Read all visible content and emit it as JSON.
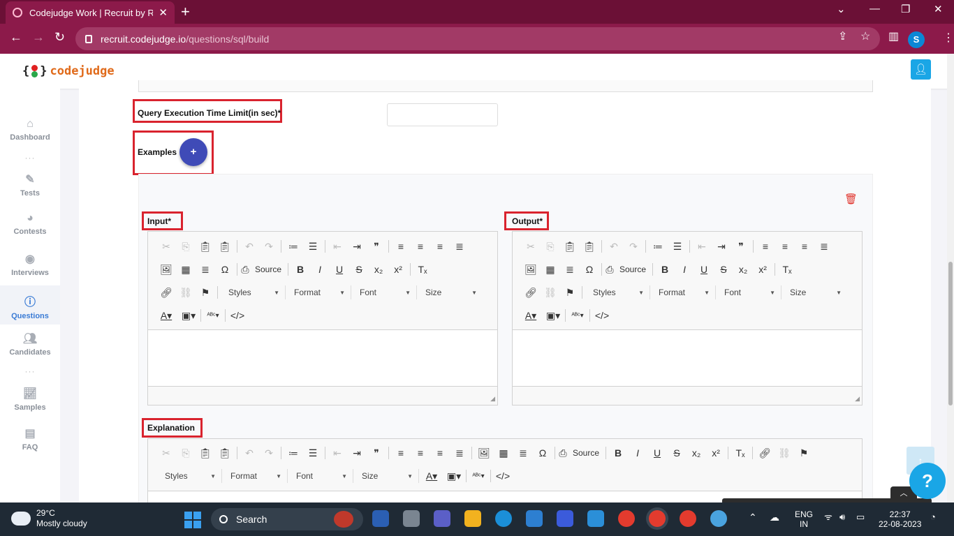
{
  "browser": {
    "tab_title": "Codejudge Work | Recruit by Rea",
    "url_host": "recruit.codejudge.io",
    "url_path": "/questions/sql/build",
    "profile_initial": "S"
  },
  "logo": {
    "word": "codejudge"
  },
  "sidebar": {
    "items": [
      {
        "label": "Dashboard",
        "icon": "home-icon"
      },
      {
        "label": "Tests",
        "icon": "pencil-icon"
      },
      {
        "label": "Contests",
        "icon": "pie-chart-icon"
      },
      {
        "label": "Interviews",
        "icon": "podcast-icon"
      },
      {
        "label": "Questions",
        "icon": "question-circle-icon",
        "active": true
      },
      {
        "label": "Candidates",
        "icon": "users-icon"
      },
      {
        "label": "Samples",
        "icon": "line-chart-icon"
      },
      {
        "label": "FAQ",
        "icon": "chat-icon"
      }
    ]
  },
  "form": {
    "time_limit_label": "Query Execution Time Limit(in sec)*",
    "examples_label": "Examples",
    "add_example": "+",
    "input_label": "Input*",
    "output_label": "Output*",
    "explanation_label": "Explanation"
  },
  "editor": {
    "source": "Source",
    "styles": "Styles",
    "format": "Format",
    "font": "Font",
    "size": "Size"
  },
  "taskbar": {
    "temperature": "29°C",
    "weather": "Mostly cloudy",
    "search": "Search",
    "lang_top": "ENG",
    "lang_bottom": "IN",
    "time": "22:37",
    "date": "22-08-2023"
  },
  "colors": {
    "brand": "#e06a1a",
    "highlight": "#d9232e",
    "accent": "#3f4bb7",
    "browser": "#8c1a4a"
  }
}
